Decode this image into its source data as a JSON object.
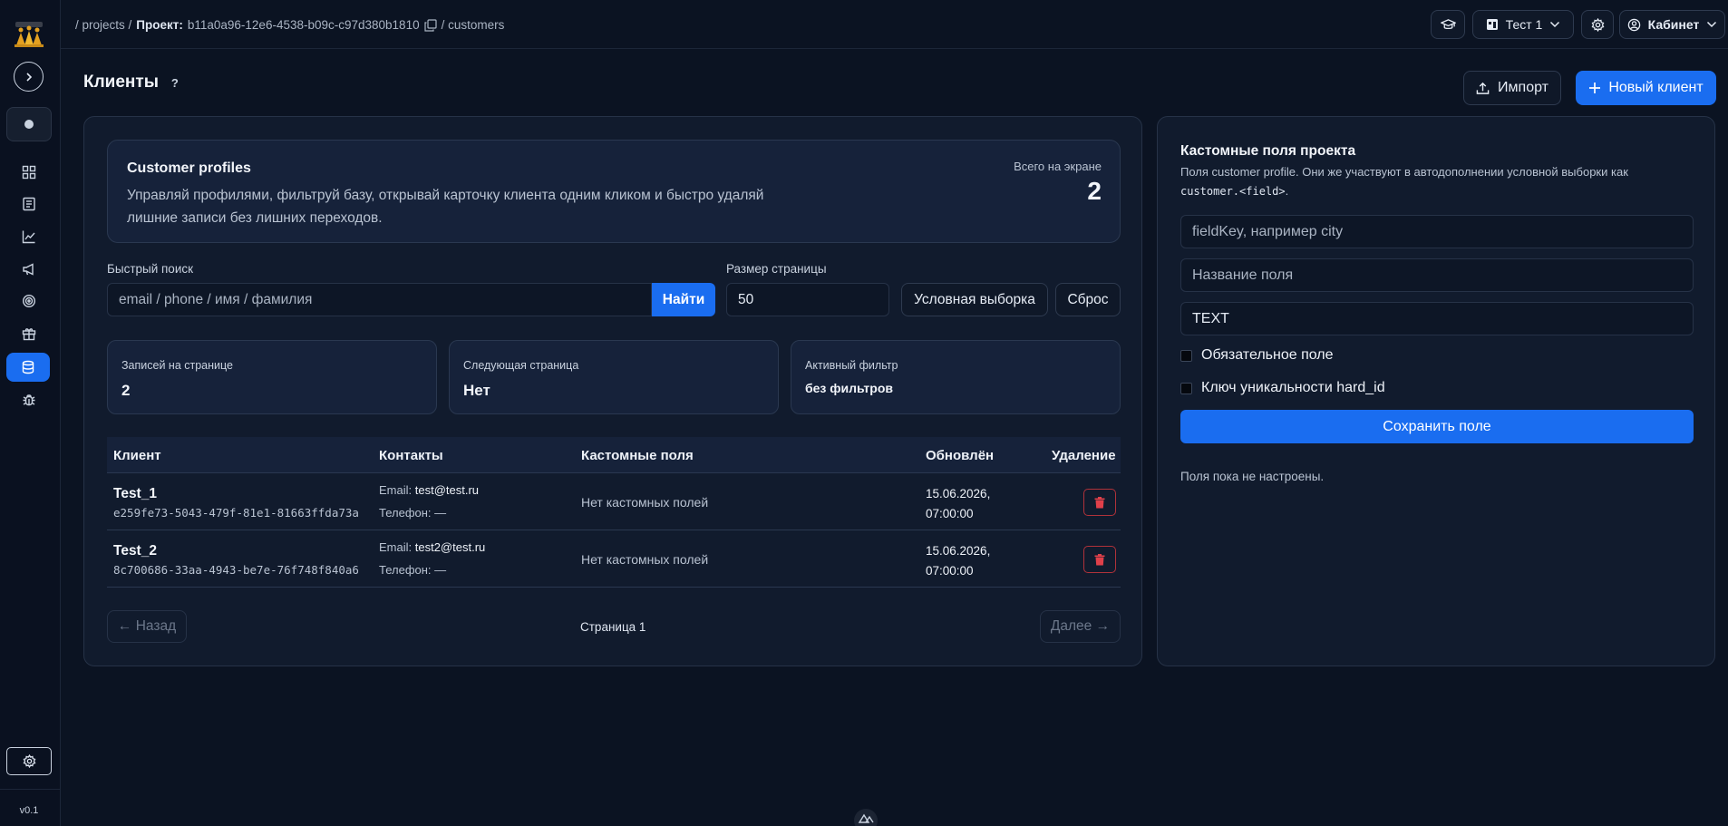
{
  "sidebar": {
    "version": "v0.1",
    "nav_icons": [
      "grid-icon",
      "document-icon",
      "chart-line-icon",
      "megaphone-icon",
      "target-icon",
      "gift-icon",
      "database-icon",
      "bug-icon"
    ]
  },
  "header": {
    "crumb_projects": "/ projects /",
    "crumb_project_label": "Проект:",
    "crumb_project_id": "b11a0a96-12e6-4538-b09c-c97d380b1810",
    "crumb_customers": "/ customers",
    "workspace": "Тест 1",
    "account": "Кабинет"
  },
  "page": {
    "title": "Клиенты",
    "help": "?",
    "import_label": "Импорт",
    "new_label": "Новый клиент"
  },
  "hero": {
    "title": "Customer profiles",
    "description": "Управляй профилями, фильтруй базу, открывай карточку клиента одним кликом и быстро удаляй лишние записи без лишних переходов.",
    "count_label": "Всего на экране",
    "count": "2"
  },
  "filters": {
    "search_label": "Быстрый поиск",
    "search_placeholder": "email / phone / имя / фамилия",
    "find_label": "Найти",
    "page_size_label": "Размер страницы",
    "page_size": "50",
    "conditional_label": "Условная выборка",
    "reset_label": "Сброс"
  },
  "stats": [
    {
      "label": "Записей на странице",
      "value": "2"
    },
    {
      "label": "Следующая страница",
      "value": "Нет"
    },
    {
      "label": "Активный фильтр",
      "value": "без фильтров"
    }
  ],
  "table": {
    "columns": [
      "Клиент",
      "Контакты",
      "Кастомные поля",
      "Обновлён",
      "Удаление"
    ],
    "rows": [
      {
        "name": "Test_1",
        "id": "e259fe73-5043-479f-81e1-81663ffda73a",
        "email_label": "Email:",
        "email": "test@test.ru",
        "phone": "Телефон: —",
        "custom": "Нет кастомных полей",
        "updated_date": "15.06.2026,",
        "updated_time": "07:00:00"
      },
      {
        "name": "Test_2",
        "id": "8c700686-33aa-4943-be7e-76f748f840a6",
        "email_label": "Email:",
        "email": "test2@test.ru",
        "phone": "Телефон: —",
        "custom": "Нет кастомных полей",
        "updated_date": "15.06.2026,",
        "updated_time": "07:00:00"
      }
    ]
  },
  "pagination": {
    "prev": "← Назад",
    "page": "Страница 1",
    "next": "Далее →"
  },
  "custom_fields": {
    "title": "Кастомные поля проекта",
    "desc_prefix": "Поля customer profile. Они же участвуют в автодополнении условной выборки как",
    "desc_code": "customer.<field>",
    "desc_suffix": ".",
    "fieldkey_placeholder": "fieldKey, например city",
    "fieldname_placeholder": "Название поля",
    "type_value": "TEXT",
    "required_label": "Обязательное поле",
    "unique_label": "Ключ уникальности hard_id",
    "save_label": "Сохранить поле",
    "empty_text": "Поля пока не настроены."
  },
  "colors": {
    "accent": "#1a6df0",
    "background": "#0b1322",
    "panel": "#111b2d",
    "danger": "#b0323a"
  }
}
